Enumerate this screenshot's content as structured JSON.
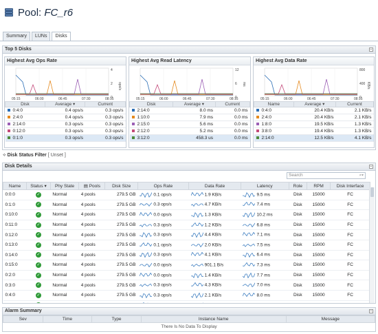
{
  "header": {
    "prefix": "Pool:",
    "name": "FC_r6"
  },
  "tabs": [
    "Summary",
    "LUNs",
    "Disks"
  ],
  "top5": {
    "title": "Top 5 Disks",
    "ops": {
      "title": "Highest Avg Ops Rate",
      "unit": "ops/s",
      "yticks": [
        "4",
        "2",
        "0"
      ],
      "xticks": [
        "05:15",
        "06:00",
        "06:45",
        "07:30",
        "08:15"
      ],
      "cols": [
        "Disk",
        "Average",
        "Current"
      ],
      "rows": [
        [
          "0:4:0",
          "0.4 ops/s",
          "0.3 ops/s"
        ],
        [
          "2:4:0",
          "0.4 ops/s",
          "0.3 ops/s"
        ],
        [
          "2:14:0",
          "0.3 ops/s",
          "0.3 ops/s"
        ],
        [
          "0:12:0",
          "0.3 ops/s",
          "0.3 ops/s"
        ],
        [
          "0:1:0",
          "0.3 ops/s",
          "0.3 ops/s"
        ]
      ]
    },
    "lat": {
      "title": "Highest Avg Read Latency",
      "unit": "ms",
      "yticks": [
        "12",
        "6",
        "0"
      ],
      "xticks": [
        "05:15",
        "06:00",
        "06:45",
        "07:30",
        "08:15"
      ],
      "cols": [
        "Disk",
        "Average",
        "Current"
      ],
      "rows": [
        [
          "2:14:0",
          "8.0 ms",
          "0.0 ms"
        ],
        [
          "1:10:0",
          "7.9 ms",
          "0.0 ms"
        ],
        [
          "2:15:0",
          "5.6 ms",
          "0.0 ms"
        ],
        [
          "2:12:0",
          "5.2 ms",
          "0.0 ms"
        ],
        [
          "3:12:0",
          "458.3 us",
          "0.0 ms"
        ]
      ]
    },
    "rate": {
      "title": "Highest Avg Data Rate",
      "unit": "KB/s",
      "yticks": [
        "800",
        "400",
        "0"
      ],
      "xticks": [
        "05:15",
        "06:00",
        "06:45",
        "07:30",
        "08:15"
      ],
      "cols": [
        "Name",
        "Average",
        "Current"
      ],
      "rows": [
        [
          "0:4:0",
          "20.4 KB/s",
          "2.1 KB/s"
        ],
        [
          "2:4:0",
          "20.4 KB/s",
          "2.1 KB/s"
        ],
        [
          "1:8:0",
          "19.5 KB/s",
          "1.3 KB/s"
        ],
        [
          "3:8:0",
          "19.4 KB/s",
          "1.3 KB/s"
        ],
        [
          "2:14:0",
          "12.5 KB/s",
          "4.1 KB/s"
        ]
      ]
    },
    "colors": [
      "#2a6db5",
      "#e58a1f",
      "#9b5fb5",
      "#c44a7a",
      "#4d8a3a"
    ]
  },
  "filter": {
    "label": "Disk Status Filter",
    "value": "[ Unset ]"
  },
  "details": {
    "title": "Disk Details",
    "search_placeholder": "Search",
    "cols": [
      "Name",
      "Status",
      "Phy State",
      "Pools",
      "Disk Size",
      "Ops Rate",
      "Data Rate",
      "Latency",
      "Role",
      "RPM",
      "Disk Interface"
    ],
    "rows": [
      [
        "0:0:0",
        "Normal",
        "4 pools",
        "279.5 GB",
        "0.1 ops/s",
        "1.9 KB/s",
        "9.5 ms",
        "Disk",
        "15000",
        "FC"
      ],
      [
        "0:1:0",
        "Normal",
        "4 pools",
        "279.5 GB",
        "0.3 ops/s",
        "4.7 KB/s",
        "7.4 ms",
        "Disk",
        "15000",
        "FC"
      ],
      [
        "0:10:0",
        "Normal",
        "4 pools",
        "279.5 GB",
        "0.0 ops/s",
        "1.3 KB/s",
        "10.2 ms",
        "Disk",
        "15000",
        "FC"
      ],
      [
        "0:11:0",
        "Normal",
        "4 pools",
        "279.5 GB",
        "0.3 ops/s",
        "1.2 KB/s",
        "6.8 ms",
        "Disk",
        "15000",
        "FC"
      ],
      [
        "0:12:0",
        "Normal",
        "4 pools",
        "279.5 GB",
        "0.3 ops/s",
        "4.4 KB/s",
        "7.1 ms",
        "Disk",
        "15000",
        "FC"
      ],
      [
        "0:13:0",
        "Normal",
        "4 pools",
        "279.5 GB",
        "0.1 ops/s",
        "2.0 KB/s",
        "7.5 ms",
        "Disk",
        "15000",
        "FC"
      ],
      [
        "0:14:0",
        "Normal",
        "4 pools",
        "279.5 GB",
        "0.3 ops/s",
        "4.1 KB/s",
        "6.4 ms",
        "Disk",
        "15000",
        "FC"
      ],
      [
        "0:15:0",
        "Normal",
        "4 pools",
        "279.5 GB",
        "0.0 ops/s",
        "901.1 B/s",
        "7.3 ms",
        "Disk",
        "15000",
        "FC"
      ],
      [
        "0:2:0",
        "Normal",
        "4 pools",
        "279.5 GB",
        "0.0 ops/s",
        "1.4 KB/s",
        "7.7 ms",
        "Disk",
        "15000",
        "FC"
      ],
      [
        "0:3:0",
        "Normal",
        "4 pools",
        "279.5 GB",
        "0.3 ops/s",
        "4.3 KB/s",
        "7.0 ms",
        "Disk",
        "15000",
        "FC"
      ],
      [
        "0:4:0",
        "Normal",
        "4 pools",
        "279.5 GB",
        "0.3 ops/s",
        "2.1 KB/s",
        "8.0 ms",
        "Disk",
        "15000",
        "FC"
      ],
      [
        "0:5:0",
        "Normal",
        "4 pools",
        "279.5 GB",
        "0.1 ops/s",
        "2.4 KB/s",
        "10.4 ms",
        "Disk",
        "15000",
        "FC"
      ]
    ]
  },
  "alarm": {
    "title": "Alarm Summary",
    "cols": [
      "Sev",
      "Time",
      "Type",
      "Instance Name",
      "Message"
    ],
    "empty": "There Is No Data To Display"
  }
}
